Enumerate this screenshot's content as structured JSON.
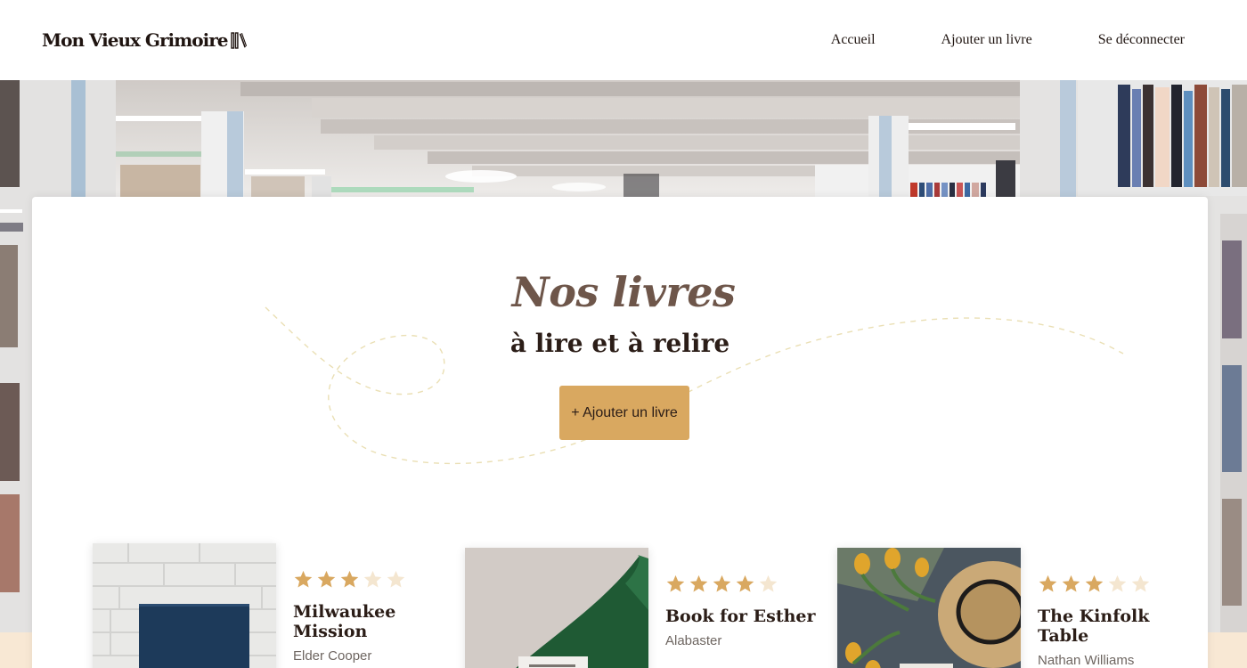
{
  "header": {
    "logo": {
      "text": "Mon Vieux Grimoire",
      "icon": "books-icon"
    },
    "nav": [
      {
        "label": "Accueil"
      },
      {
        "label": "Ajouter un livre"
      },
      {
        "label": "Se déconnecter"
      }
    ]
  },
  "hero": {
    "title": "Nos livres",
    "subtitle": "à lire et à relire",
    "add_button_label": "+ Ajouter un livre"
  },
  "books": [
    {
      "title": "Milwaukee Mission",
      "author": "Elder Cooper",
      "rating": 3,
      "max_rating": 5
    },
    {
      "title": "Book for Esther",
      "author": "Alabaster",
      "rating": 4,
      "max_rating": 5
    },
    {
      "title": "The Kinfolk Table",
      "author": "Nathan Williams",
      "rating": 3,
      "max_rating": 5
    }
  ],
  "colors": {
    "accent": "#d9a860",
    "star_filled": "#d9a860",
    "star_empty": "#f4e6d0",
    "title_brown": "#6e564a",
    "text_dark": "#2b1d17",
    "muted": "#6e6661",
    "beige_band": "#f8e8d4"
  }
}
